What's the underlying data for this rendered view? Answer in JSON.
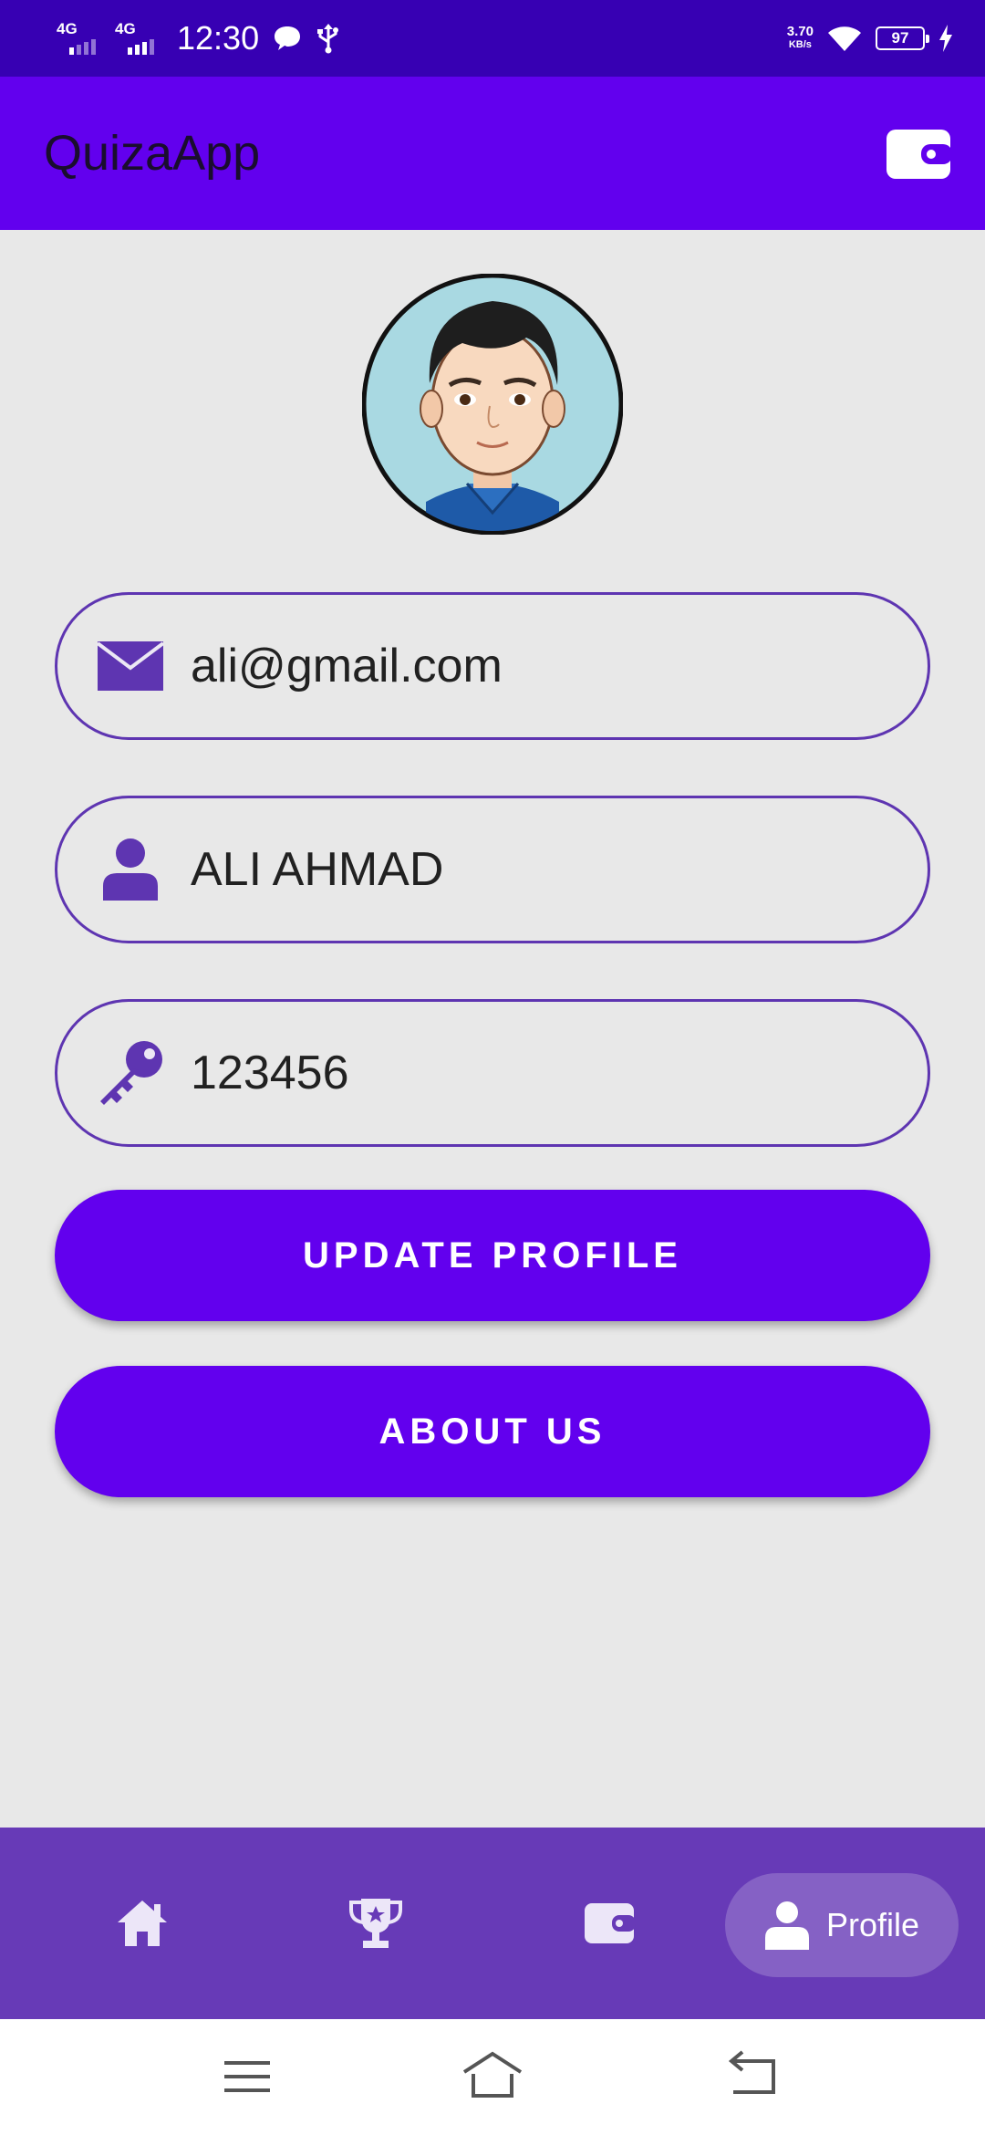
{
  "status_bar": {
    "network_1": "4G",
    "network_2": "4G",
    "time": "12:30",
    "speed_value": "3.70",
    "speed_unit": "KB/s",
    "battery": "97"
  },
  "app_bar": {
    "title": "QuizaApp"
  },
  "profile": {
    "email": "ali@gmail.com",
    "name": "ALI AHMAD",
    "password": "123456"
  },
  "buttons": {
    "update_profile": "UPDATE PROFILE",
    "about_us": "ABOUT US"
  },
  "bottom_nav": {
    "items": [
      {
        "icon": "home-icon"
      },
      {
        "icon": "trophy-icon"
      },
      {
        "icon": "wallet-icon"
      },
      {
        "icon": "profile-icon",
        "label": "Profile",
        "active": true
      }
    ]
  },
  "colors": {
    "status_bar": "#3700b3",
    "app_bar": "#6200ee",
    "accent": "#5e35b1",
    "bottom_nav": "#673ab7",
    "background": "#e8e8e8"
  }
}
